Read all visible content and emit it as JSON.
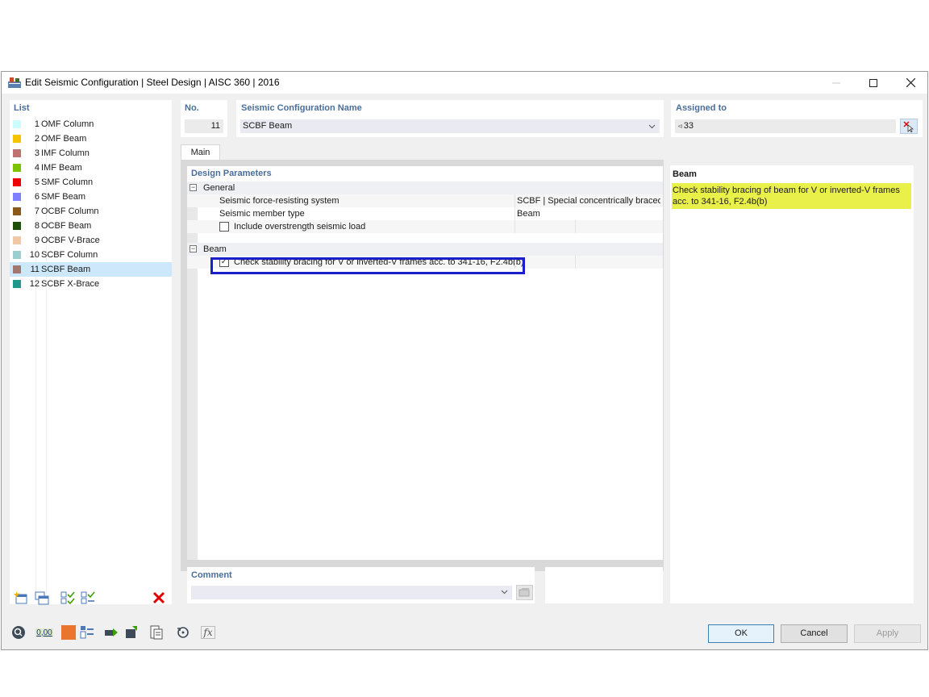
{
  "window": {
    "title": "Edit Seismic Configuration | Steel Design | AISC 360 | 2016"
  },
  "list": {
    "header": "List",
    "items": [
      {
        "num": "1",
        "label": "OMF Column",
        "color": "#ccfcfc"
      },
      {
        "num": "2",
        "label": "OMF Beam",
        "color": "#f6c300"
      },
      {
        "num": "3",
        "label": "IMF Column",
        "color": "#c07272"
      },
      {
        "num": "4",
        "label": "IMF Beam",
        "color": "#7cc400"
      },
      {
        "num": "5",
        "label": "SMF Column",
        "color": "#f00000"
      },
      {
        "num": "6",
        "label": "SMF Beam",
        "color": "#8080ff"
      },
      {
        "num": "7",
        "label": "OCBF Column",
        "color": "#8a5a1c"
      },
      {
        "num": "8",
        "label": "OCBF Beam",
        "color": "#1f4f0a"
      },
      {
        "num": "9",
        "label": "OCBF V-Brace",
        "color": "#efc9a6"
      },
      {
        "num": "10",
        "label": "SCBF Column",
        "color": "#9bcfcf"
      },
      {
        "num": "11",
        "label": "SCBF Beam",
        "color": "#a07870"
      },
      {
        "num": "12",
        "label": "SCBF X-Brace",
        "color": "#1f9a8a"
      }
    ],
    "selected_index": 10
  },
  "no": {
    "header": "No.",
    "value": "11"
  },
  "name": {
    "header": "Seismic Configuration Name",
    "value": "SCBF Beam"
  },
  "assigned": {
    "header": "Assigned to",
    "prefix": "⊲",
    "value": "33"
  },
  "tabs": {
    "main": "Main"
  },
  "design_parameters": {
    "header": "Design Parameters",
    "general": {
      "label": "General",
      "rows": [
        {
          "label": "Seismic force-resisting system",
          "value": "SCBF | Special concentrically braced ..."
        },
        {
          "label": "Seismic member type",
          "value": "Beam"
        }
      ],
      "include_overstrength": {
        "label": "Include overstrength seismic load",
        "checked": false
      }
    },
    "beam": {
      "label": "Beam",
      "check_stability": {
        "label": "Check stability bracing for V or inverted-V frames acc. to 341-16, F2.4b(b)",
        "checked": true
      }
    }
  },
  "info": {
    "title": "Beam",
    "text": "Check stability bracing of beam for V or inverted-V frames acc. to 341-16, F2.4b(b)"
  },
  "comment": {
    "header": "Comment",
    "value": ""
  },
  "buttons": {
    "ok": "OK",
    "cancel": "Cancel",
    "apply": "Apply"
  },
  "bottom_toolbar": {
    "decimal_label": "0,00",
    "fx_label": "fx"
  },
  "colors": {
    "accent_header": "#4a6e9a",
    "selection": "#cde8fb",
    "info_highlight": "#eaf04a",
    "focus_border": "#1a1fc9"
  }
}
